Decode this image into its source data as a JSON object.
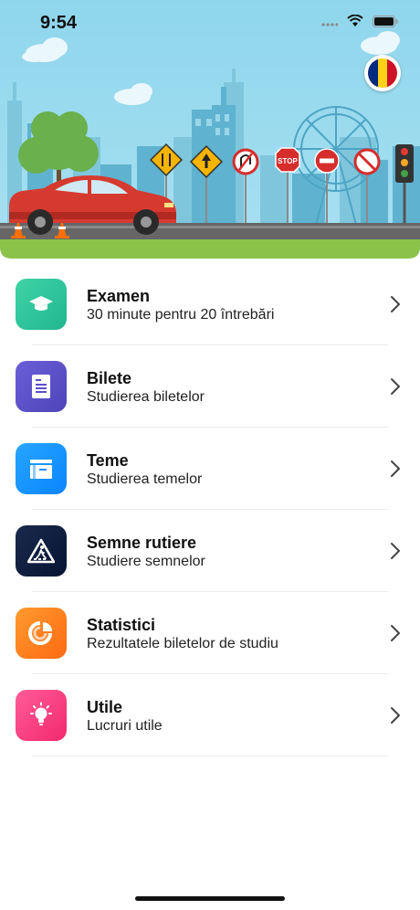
{
  "status_bar": {
    "time": "9:54"
  },
  "header": {
    "language_flag": "flag-romania-icon",
    "flag_colors": [
      "#002B7F",
      "#FCD116",
      "#CE1126"
    ]
  },
  "menu": {
    "items": [
      {
        "title": "Examen",
        "subtitle": "30 minute pentru 20 întrebări",
        "icon": "graduation-cap-icon",
        "color_from": "#3fd3a6",
        "color_to": "#22b68f"
      },
      {
        "title": "Bilete",
        "subtitle": "Studierea biletelor",
        "icon": "document-icon",
        "color_from": "#6a5fd8",
        "color_to": "#4f44b8"
      },
      {
        "title": "Teme",
        "subtitle": "Studierea temelor",
        "icon": "folder-icon",
        "color_from": "#27a6ff",
        "color_to": "#0a84ff"
      },
      {
        "title": "Semne rutiere",
        "subtitle": "Studiere semnelor",
        "icon": "pedestrian-crossing-icon",
        "color_from": "#1a2a4c",
        "color_to": "#071433"
      },
      {
        "title": "Statistici",
        "subtitle": "Rezultatele biletelor de studiu",
        "icon": "pie-chart-icon",
        "color_from": "#ff9a2e",
        "color_to": "#ff6a13"
      },
      {
        "title": "Utile",
        "subtitle": "Lucruri utile",
        "icon": "lightbulb-icon",
        "color_from": "#ff5c98",
        "color_to": "#f2296e"
      }
    ]
  },
  "illustration": {
    "stop_sign_text": "STOP"
  }
}
